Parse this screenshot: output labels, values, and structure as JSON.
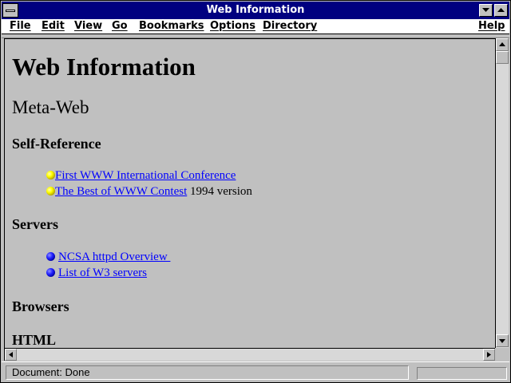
{
  "window": {
    "title": "Web Information"
  },
  "menu": {
    "items": [
      "File",
      "Edit",
      "View",
      "Go",
      "Bookmarks",
      "Options",
      "Directory",
      "Help"
    ]
  },
  "page": {
    "h1": "Web Information",
    "h2": "Meta-Web",
    "sections": [
      {
        "heading": "Self-Reference",
        "bullet_color": "yellow",
        "items": [
          {
            "link": "First WWW International Conference",
            "text": ""
          },
          {
            "link": "The Best of WWW Contest",
            "text": " 1994 version"
          }
        ]
      },
      {
        "heading": "Servers",
        "bullet_color": "blue",
        "items": [
          {
            "link": "NCSA httpd Overview ",
            "text": ""
          },
          {
            "link": "List of W3 servers",
            "text": ""
          }
        ]
      },
      {
        "heading": "Browsers"
      },
      {
        "heading": "HTML"
      }
    ]
  },
  "status": {
    "text": "Document: Done"
  },
  "colors": {
    "titlebar": "#000080",
    "background": "#c0c0c0",
    "link": "#0000ff",
    "bullet_yellow": "#ffff00",
    "bullet_blue": "#0000ff"
  },
  "icons": [
    "system-menu-icon",
    "minimize-arrow-icon",
    "maximize-arrow-icon",
    "scroll-up-arrow-icon",
    "scroll-down-arrow-icon",
    "scroll-left-arrow-icon",
    "scroll-right-arrow-icon",
    "bullet-icon"
  ]
}
